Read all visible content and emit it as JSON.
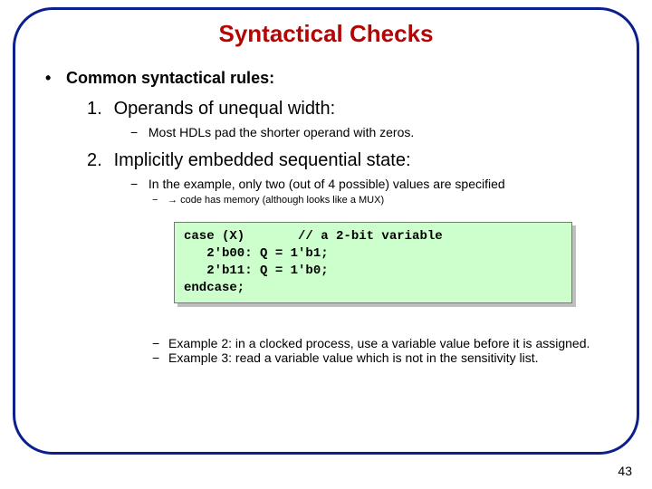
{
  "title": "Syntactical Checks",
  "bullet_symbol": "•",
  "dash_symbol": "−",
  "sub_dash_symbol": "−",
  "arrow_symbol": "→",
  "lvl1_text": "Common syntactical rules:",
  "items": [
    {
      "num": "1.",
      "text": "Operands of unequal width:",
      "sub": [
        {
          "text": "Most HDLs pad the shorter operand with zeros."
        }
      ]
    },
    {
      "num": "2.",
      "text": "Implicitly embedded sequential state:",
      "sub": [
        {
          "text": "In the example, only two  (out of 4 possible) values are specified",
          "subsub": [
            {
              "text": " code has memory (although looks like a MUX)"
            }
          ]
        }
      ]
    }
  ],
  "code": "case (X)       // a 2-bit variable\n   2'b00: Q = 1'b1;\n   2'b11: Q = 1'b0;\nendcase;",
  "examples": [
    {
      "label": "Example 2:",
      "text": " in a clocked process, use a variable value before it is assigned."
    },
    {
      "label": "Example 3:",
      "text": " read a variable value which is not in the sensitivity list."
    }
  ],
  "page_number": "43"
}
